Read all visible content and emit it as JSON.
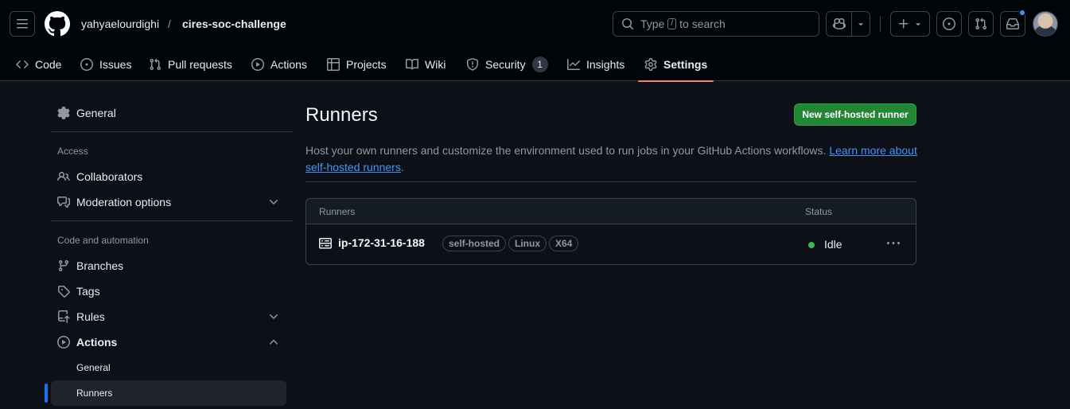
{
  "header": {
    "owner": "yahyaelourdighi",
    "separator": "/",
    "repo": "cires-soc-challenge",
    "search": {
      "prefix": "Type",
      "key": "/",
      "suffix": "to search"
    },
    "avatar_icon": "user-avatar"
  },
  "repo_tabs": [
    {
      "label": "Code",
      "icon": "code-icon"
    },
    {
      "label": "Issues",
      "icon": "issue-opened-icon"
    },
    {
      "label": "Pull requests",
      "icon": "git-pull-request-icon"
    },
    {
      "label": "Actions",
      "icon": "play-icon"
    },
    {
      "label": "Projects",
      "icon": "table-icon"
    },
    {
      "label": "Wiki",
      "icon": "book-icon"
    },
    {
      "label": "Security",
      "icon": "shield-icon",
      "count": "1"
    },
    {
      "label": "Insights",
      "icon": "graph-icon"
    },
    {
      "label": "Settings",
      "icon": "gear-icon",
      "active": true
    }
  ],
  "sidebar": {
    "general": "General",
    "access_heading": "Access",
    "collaborators": "Collaborators",
    "moderation": "Moderation options",
    "code_heading": "Code and automation",
    "branches": "Branches",
    "tags": "Tags",
    "rules": "Rules",
    "actions": "Actions",
    "actions_general": "General",
    "actions_runners": "Runners"
  },
  "main": {
    "title": "Runners",
    "new_button": "New self-hosted runner",
    "description": "Host your own runners and customize the environment used to run jobs in your GitHub Actions workflows. ",
    "learn_more": "Learn more about self-hosted runners",
    "description_end": "."
  },
  "table": {
    "col_runners": "Runners",
    "col_status": "Status",
    "runner": {
      "name": "ip-172-31-16-188",
      "labels": [
        "self-hosted",
        "Linux",
        "X64"
      ],
      "status": "Idle",
      "status_color": "#3fb950"
    }
  },
  "colors": {
    "accent": "#f78166",
    "primary_button": "#238636",
    "link": "#4493f8",
    "selection_bar": "#1f6feb"
  }
}
